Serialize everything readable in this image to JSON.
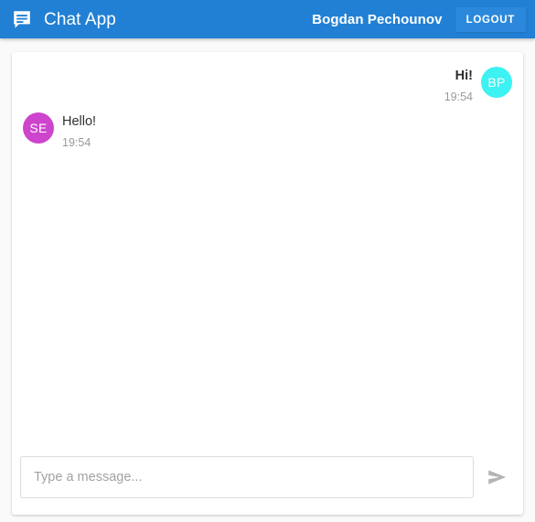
{
  "header": {
    "icon": "chat-bubble-icon",
    "title": "Chat App",
    "username": "Bogdan Pechounov",
    "logout_label": "LOGOUT",
    "background_color": "#2180d4",
    "text_color": "#ffffff"
  },
  "messages": [
    {
      "id": "msg-1",
      "direction": "outgoing",
      "avatar_initials": "BP",
      "avatar_color": "#3df2f2",
      "text": "Hi!",
      "time": "19:54"
    },
    {
      "id": "msg-2",
      "direction": "incoming",
      "avatar_initials": "SE",
      "avatar_color": "#cc45cc",
      "text": "Hello!",
      "time": "19:54"
    }
  ],
  "composer": {
    "input_value": "",
    "placeholder": "Type a message...",
    "send_icon": "send-arrow-icon",
    "send_icon_color": "#b0b0b0"
  }
}
